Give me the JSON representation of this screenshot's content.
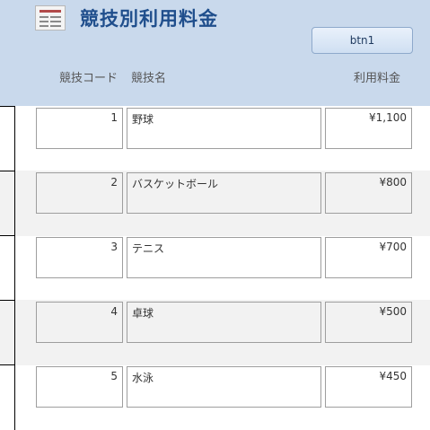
{
  "header": {
    "title": "競技別利用料金",
    "button_label": "btn1"
  },
  "columns": {
    "id": "競技コード",
    "name": "競技名",
    "fee": "利用料金"
  },
  "rows": [
    {
      "id": "1",
      "name": "野球",
      "fee": "¥1,100"
    },
    {
      "id": "2",
      "name": "バスケットボール",
      "fee": "¥800"
    },
    {
      "id": "3",
      "name": "テニス",
      "fee": "¥700"
    },
    {
      "id": "4",
      "name": "卓球",
      "fee": "¥500"
    },
    {
      "id": "5",
      "name": "水泳",
      "fee": "¥450"
    }
  ],
  "colors": {
    "header_background": "#c9d9ec",
    "title": "#1f4e8c",
    "alternate_row": "#f2f2f2"
  },
  "icons": {
    "form": "form-icon"
  }
}
